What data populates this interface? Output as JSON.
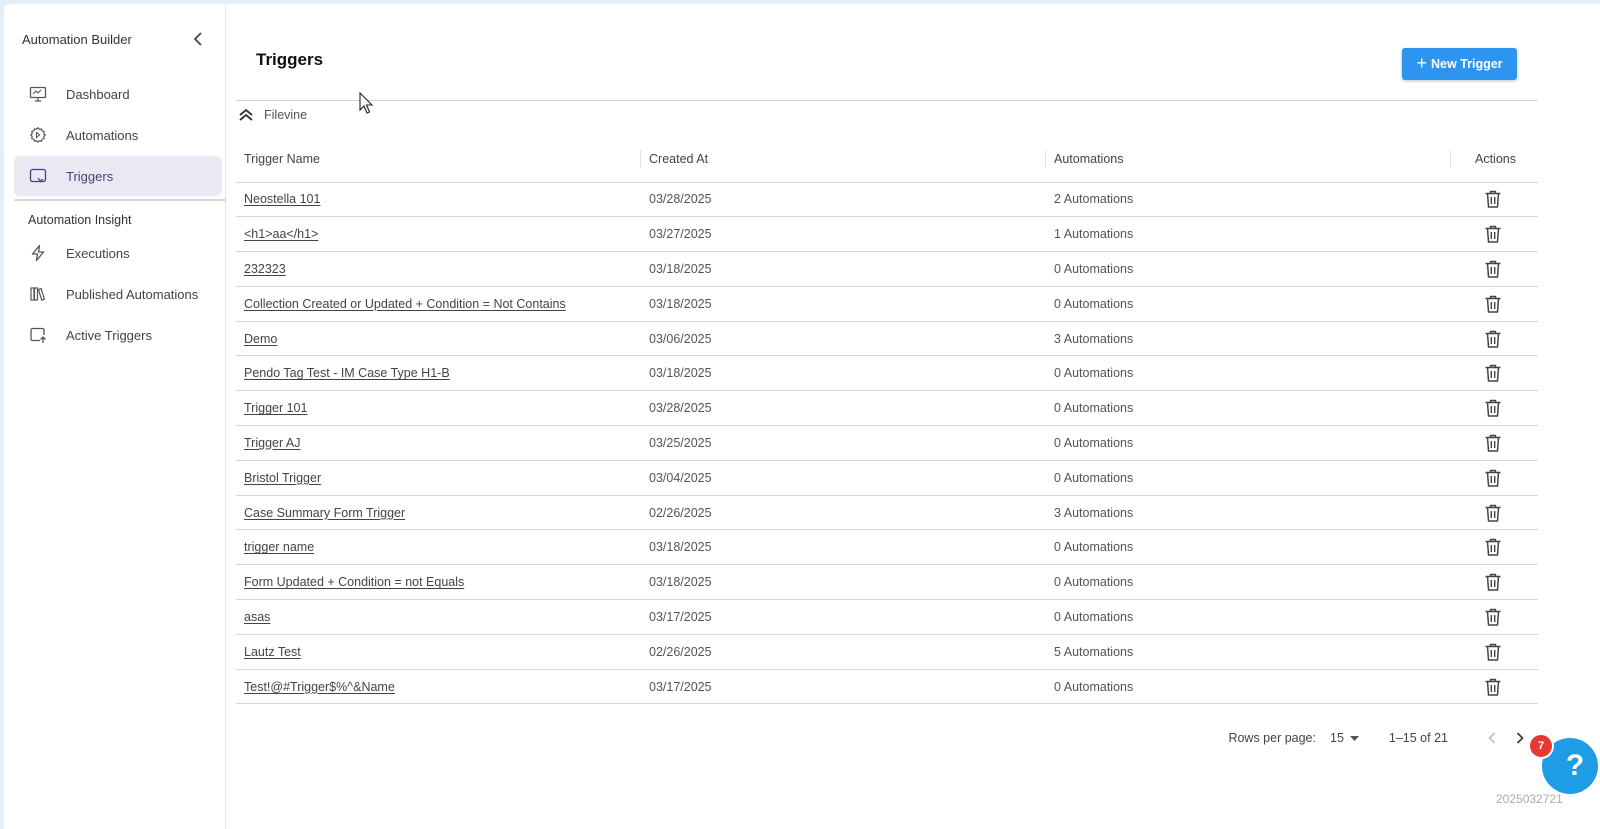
{
  "sidebar": {
    "title": "Automation Builder",
    "items": [
      {
        "label": "Dashboard",
        "icon": "monitor-icon"
      },
      {
        "label": "Automations",
        "icon": "gear-icon"
      },
      {
        "label": "Triggers",
        "icon": "trigger-screen-icon",
        "active": true
      }
    ],
    "section_label": "Automation Insight",
    "insight_items": [
      {
        "label": "Executions",
        "icon": "lightning-icon"
      },
      {
        "label": "Published Automations",
        "icon": "books-icon"
      },
      {
        "label": "Active Triggers",
        "icon": "active-trigger-icon"
      }
    ]
  },
  "page": {
    "title": "Triggers",
    "new_button_label": "New Trigger",
    "group_label": "Filevine"
  },
  "table": {
    "columns": [
      "Trigger Name",
      "Created At",
      "Automations",
      "Actions"
    ],
    "rows": [
      {
        "name": "Neostella 101",
        "created": "03/28/2025",
        "automations": "2 Automations"
      },
      {
        "name": "<h1>aa</h1>",
        "created": "03/27/2025",
        "automations": "1 Automations"
      },
      {
        "name": "232323",
        "created": "03/18/2025",
        "automations": "0 Automations"
      },
      {
        "name": "Collection Created or Updated + Condition = Not Contains",
        "created": "03/18/2025",
        "automations": "0 Automations"
      },
      {
        "name": "Demo",
        "created": "03/06/2025",
        "automations": "3 Automations"
      },
      {
        "name": "Pendo Tag Test - IM Case Type H1-B",
        "created": "03/18/2025",
        "automations": "0 Automations"
      },
      {
        "name": "Trigger 101",
        "created": "03/28/2025",
        "automations": "0 Automations"
      },
      {
        "name": "Trigger AJ",
        "created": "03/25/2025",
        "automations": "0 Automations"
      },
      {
        "name": "Bristol Trigger",
        "created": "03/04/2025",
        "automations": "0 Automations"
      },
      {
        "name": "Case Summary Form Trigger",
        "created": "02/26/2025",
        "automations": "3 Automations"
      },
      {
        "name": "trigger name",
        "created": "03/18/2025",
        "automations": "0 Automations"
      },
      {
        "name": "Form Updated + Condition = not Equals",
        "created": "03/18/2025",
        "automations": "0 Automations"
      },
      {
        "name": "asas",
        "created": "03/17/2025",
        "automations": "0 Automations"
      },
      {
        "name": "Lautz Test",
        "created": "02/26/2025",
        "automations": "5 Automations"
      },
      {
        "name": "Test!@#Trigger$%^&Name",
        "created": "03/17/2025",
        "automations": "0 Automations"
      }
    ]
  },
  "pagination": {
    "rows_per_page_label": "Rows per page:",
    "rows_per_page_value": "15",
    "range_text": "1–15 of 21"
  },
  "help": {
    "badge_count": "7",
    "glyph": "?"
  },
  "watermark": "2025032721",
  "colors": {
    "accent": "#2d95f0",
    "active_nav_bg": "#ebe7f3",
    "badge": "#e53935"
  }
}
